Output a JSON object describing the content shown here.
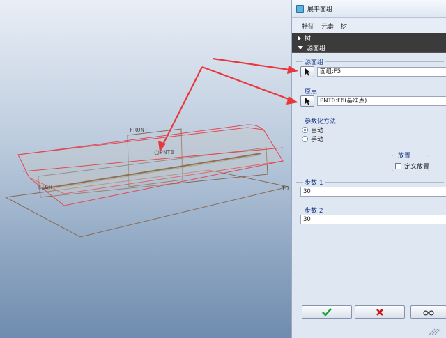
{
  "dialog": {
    "title": "展平面组",
    "menu": [
      "特征",
      "元素",
      "树"
    ],
    "tree_header": "树",
    "source_group_header": "源面组",
    "sections": {
      "source_surface": {
        "label": "源面组",
        "value": "面组:F5"
      },
      "origin": {
        "label": "原点",
        "value": "PNT0:F6(基准点)"
      },
      "param_method": {
        "label": "参数化方法",
        "options": [
          "自动",
          "手动"
        ],
        "selected": "自动"
      },
      "placement": {
        "label": "放置",
        "checkbox_label": "定义放置",
        "checked": false
      },
      "step1": {
        "label": "步数 1",
        "value": "30"
      },
      "step2": {
        "label": "步数 2",
        "value": "30"
      }
    },
    "buttons": {
      "ok": "check-icon",
      "cancel": "x-icon",
      "preview": "glasses-icon"
    }
  },
  "viewport": {
    "labels": {
      "front": "FRONT",
      "point": "PNT0",
      "right": "RIGHT",
      "top": "TO"
    }
  },
  "colors": {
    "annotation_arrow": "#e8383d",
    "accent": "#1f3c88",
    "tree_bg": "#3b3b3b"
  }
}
